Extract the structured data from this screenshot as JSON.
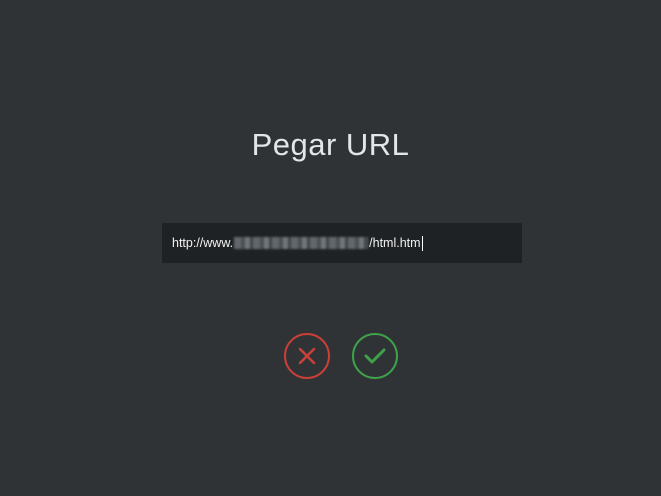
{
  "dialog": {
    "title": "Pegar URL",
    "url_input": {
      "value_prefix": "http://www.",
      "value_suffix": "/html.htm",
      "redacted_segment": true
    },
    "cancel_button": {
      "icon": "close-icon",
      "color": "#c9403a"
    },
    "confirm_button": {
      "icon": "check-icon",
      "color": "#3fa14a"
    }
  },
  "colors": {
    "background": "#2f3336",
    "input_background": "#1f2224",
    "title_text": "#e3e5e6"
  }
}
